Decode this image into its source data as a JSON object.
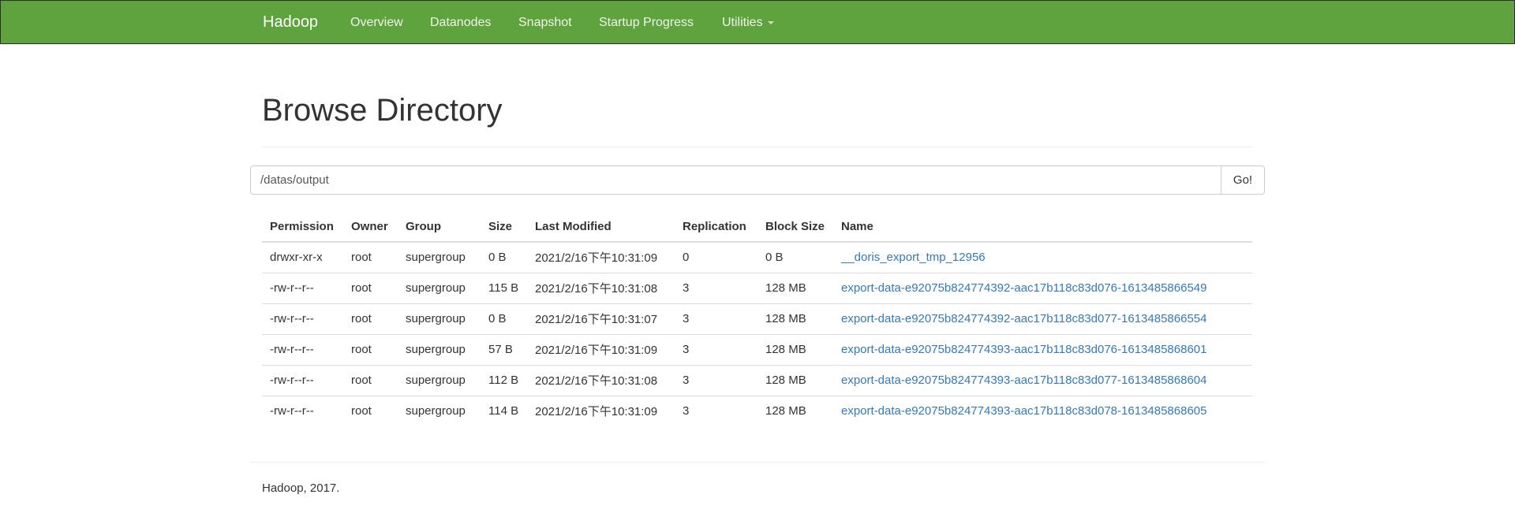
{
  "navbar": {
    "brand": "Hadoop",
    "items": [
      {
        "label": "Overview"
      },
      {
        "label": "Datanodes"
      },
      {
        "label": "Snapshot"
      },
      {
        "label": "Startup Progress"
      },
      {
        "label": "Utilities"
      }
    ]
  },
  "page": {
    "title": "Browse Directory"
  },
  "path_bar": {
    "value": "/datas/output",
    "go_label": "Go!"
  },
  "table": {
    "headers": [
      "Permission",
      "Owner",
      "Group",
      "Size",
      "Last Modified",
      "Replication",
      "Block Size",
      "Name"
    ],
    "rows": [
      {
        "permission": "drwxr-xr-x",
        "owner": "root",
        "group": "supergroup",
        "size": "0 B",
        "modified": "2021/2/16下午10:31:09",
        "replication": "0",
        "block_size": "0 B",
        "name": "__doris_export_tmp_12956"
      },
      {
        "permission": "-rw-r--r--",
        "owner": "root",
        "group": "supergroup",
        "size": "115 B",
        "modified": "2021/2/16下午10:31:08",
        "replication": "3",
        "block_size": "128 MB",
        "name": "export-data-e92075b824774392-aac17b118c83d076-1613485866549"
      },
      {
        "permission": "-rw-r--r--",
        "owner": "root",
        "group": "supergroup",
        "size": "0 B",
        "modified": "2021/2/16下午10:31:07",
        "replication": "3",
        "block_size": "128 MB",
        "name": "export-data-e92075b824774392-aac17b118c83d077-1613485866554"
      },
      {
        "permission": "-rw-r--r--",
        "owner": "root",
        "group": "supergroup",
        "size": "57 B",
        "modified": "2021/2/16下午10:31:09",
        "replication": "3",
        "block_size": "128 MB",
        "name": "export-data-e92075b824774393-aac17b118c83d076-1613485868601"
      },
      {
        "permission": "-rw-r--r--",
        "owner": "root",
        "group": "supergroup",
        "size": "112 B",
        "modified": "2021/2/16下午10:31:08",
        "replication": "3",
        "block_size": "128 MB",
        "name": "export-data-e92075b824774393-aac17b118c83d077-1613485868604"
      },
      {
        "permission": "-rw-r--r--",
        "owner": "root",
        "group": "supergroup",
        "size": "114 B",
        "modified": "2021/2/16下午10:31:09",
        "replication": "3",
        "block_size": "128 MB",
        "name": "export-data-e92075b824774393-aac17b118c83d078-1613485868605"
      }
    ]
  },
  "footer": {
    "text": "Hadoop, 2017."
  },
  "colors": {
    "navbar_bg": "#5fa33e",
    "link": "#337ab7",
    "rule": "#dddddd"
  }
}
